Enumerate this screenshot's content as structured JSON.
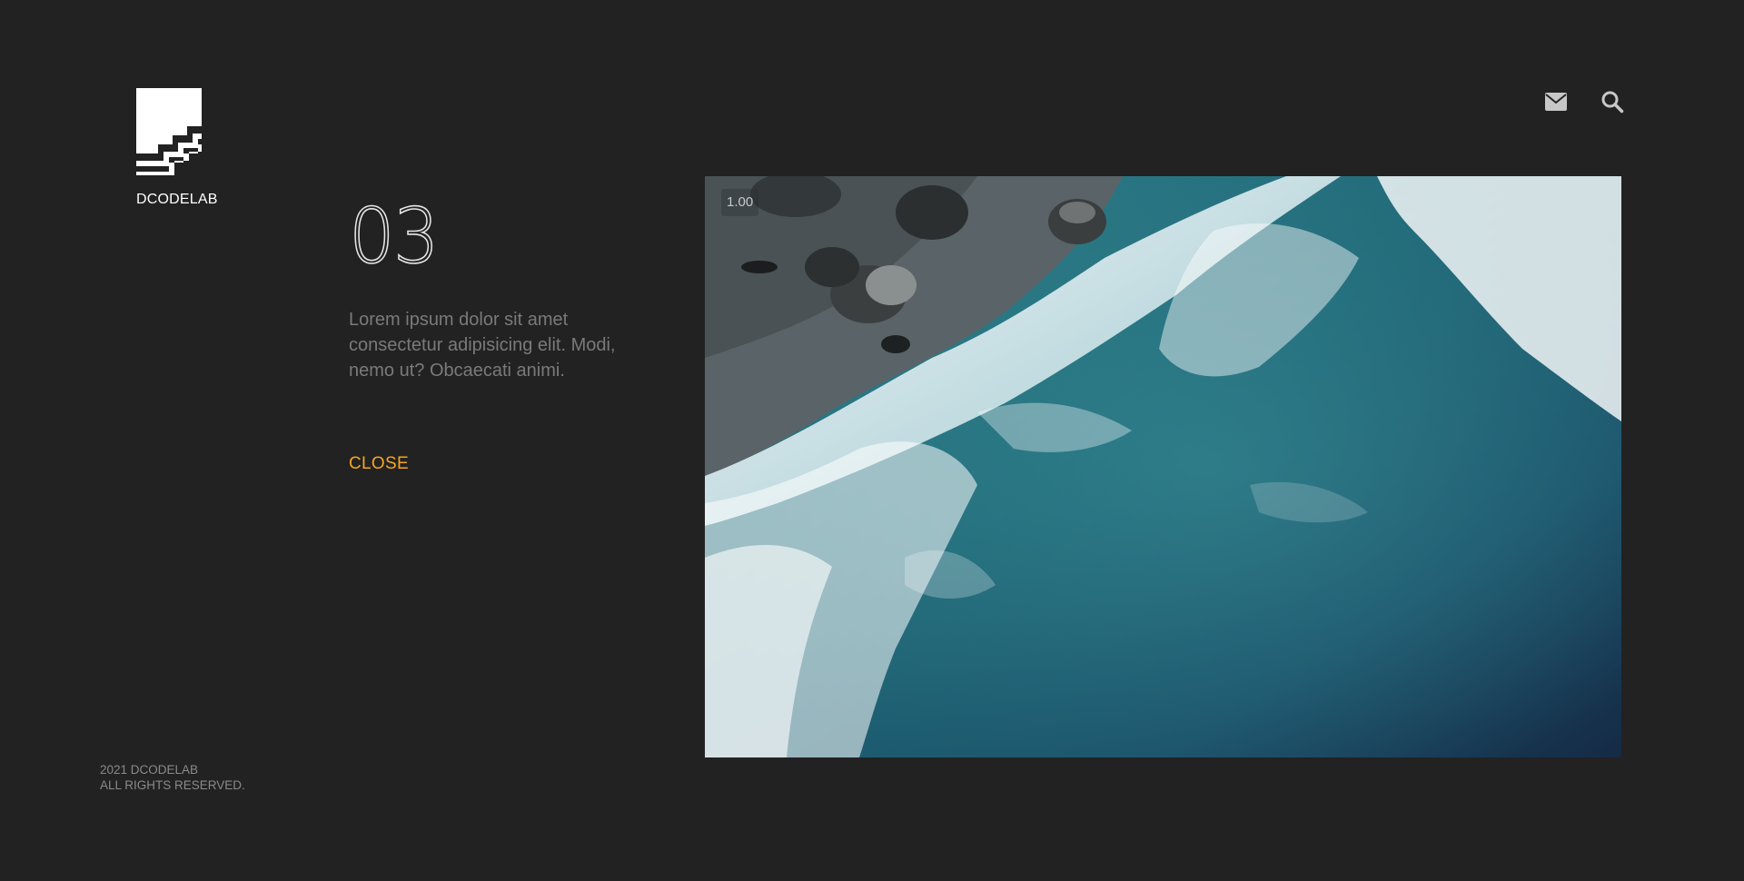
{
  "brand": {
    "name": "DCODELAB"
  },
  "header": {
    "icons": [
      "envelope-icon",
      "search-icon"
    ]
  },
  "slide": {
    "number": "03",
    "description": "Lorem ipsum dolor sit amet consectetur adipisicing elit. Modi, nemo ut? Obcaecati animi.",
    "close_label": "CLOSE"
  },
  "media": {
    "speed_label": "1.00"
  },
  "footer": {
    "line1": "2021 DCODELAB",
    "line2": "ALL RIGHTS RESERVED."
  },
  "colors": {
    "background": "#222222",
    "accent": "#f5a623",
    "text_muted": "#7a7a7a",
    "icon": "#c7c7c7"
  }
}
